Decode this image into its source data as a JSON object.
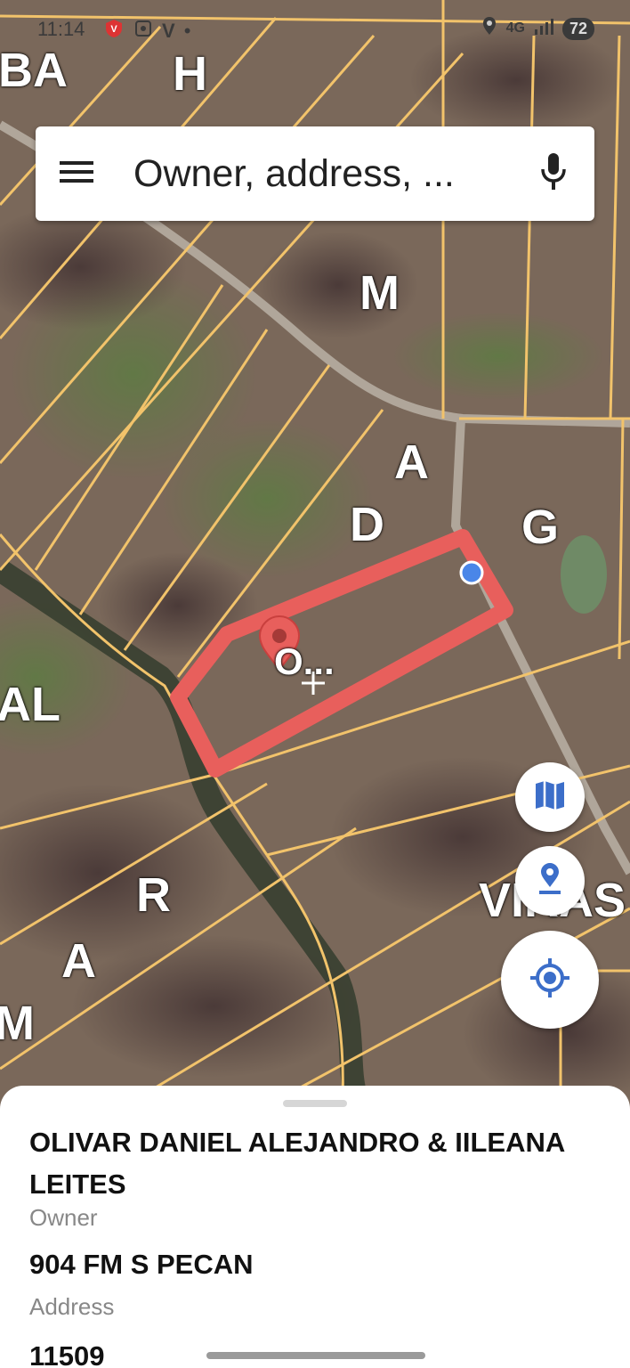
{
  "status_bar": {
    "time": "11:14",
    "network": "4G",
    "battery": "72"
  },
  "map": {
    "parcel_labels": [
      "BA",
      "H",
      "M",
      "A",
      "D",
      "G",
      "O...",
      "AL",
      "R",
      "A",
      "M",
      "VIRAS"
    ],
    "selected_outline_color": "#e85f5c",
    "parcel_line_color": "#f2c36b",
    "current_location_color": "#4a86e8"
  },
  "search": {
    "placeholder": "Owner, address, ..."
  },
  "buttons": {
    "map_type_icon": "map-icon",
    "place_pin_icon": "place-pin-icon",
    "my_location_icon": "my-location-icon"
  },
  "details": {
    "owner_name": "OLIVAR DANIEL ALEJANDRO & IILEANA LEITES",
    "owner_caption": "Owner",
    "address": "904 FM S PECAN",
    "address_caption": "Address",
    "parcel_id": "11509"
  }
}
